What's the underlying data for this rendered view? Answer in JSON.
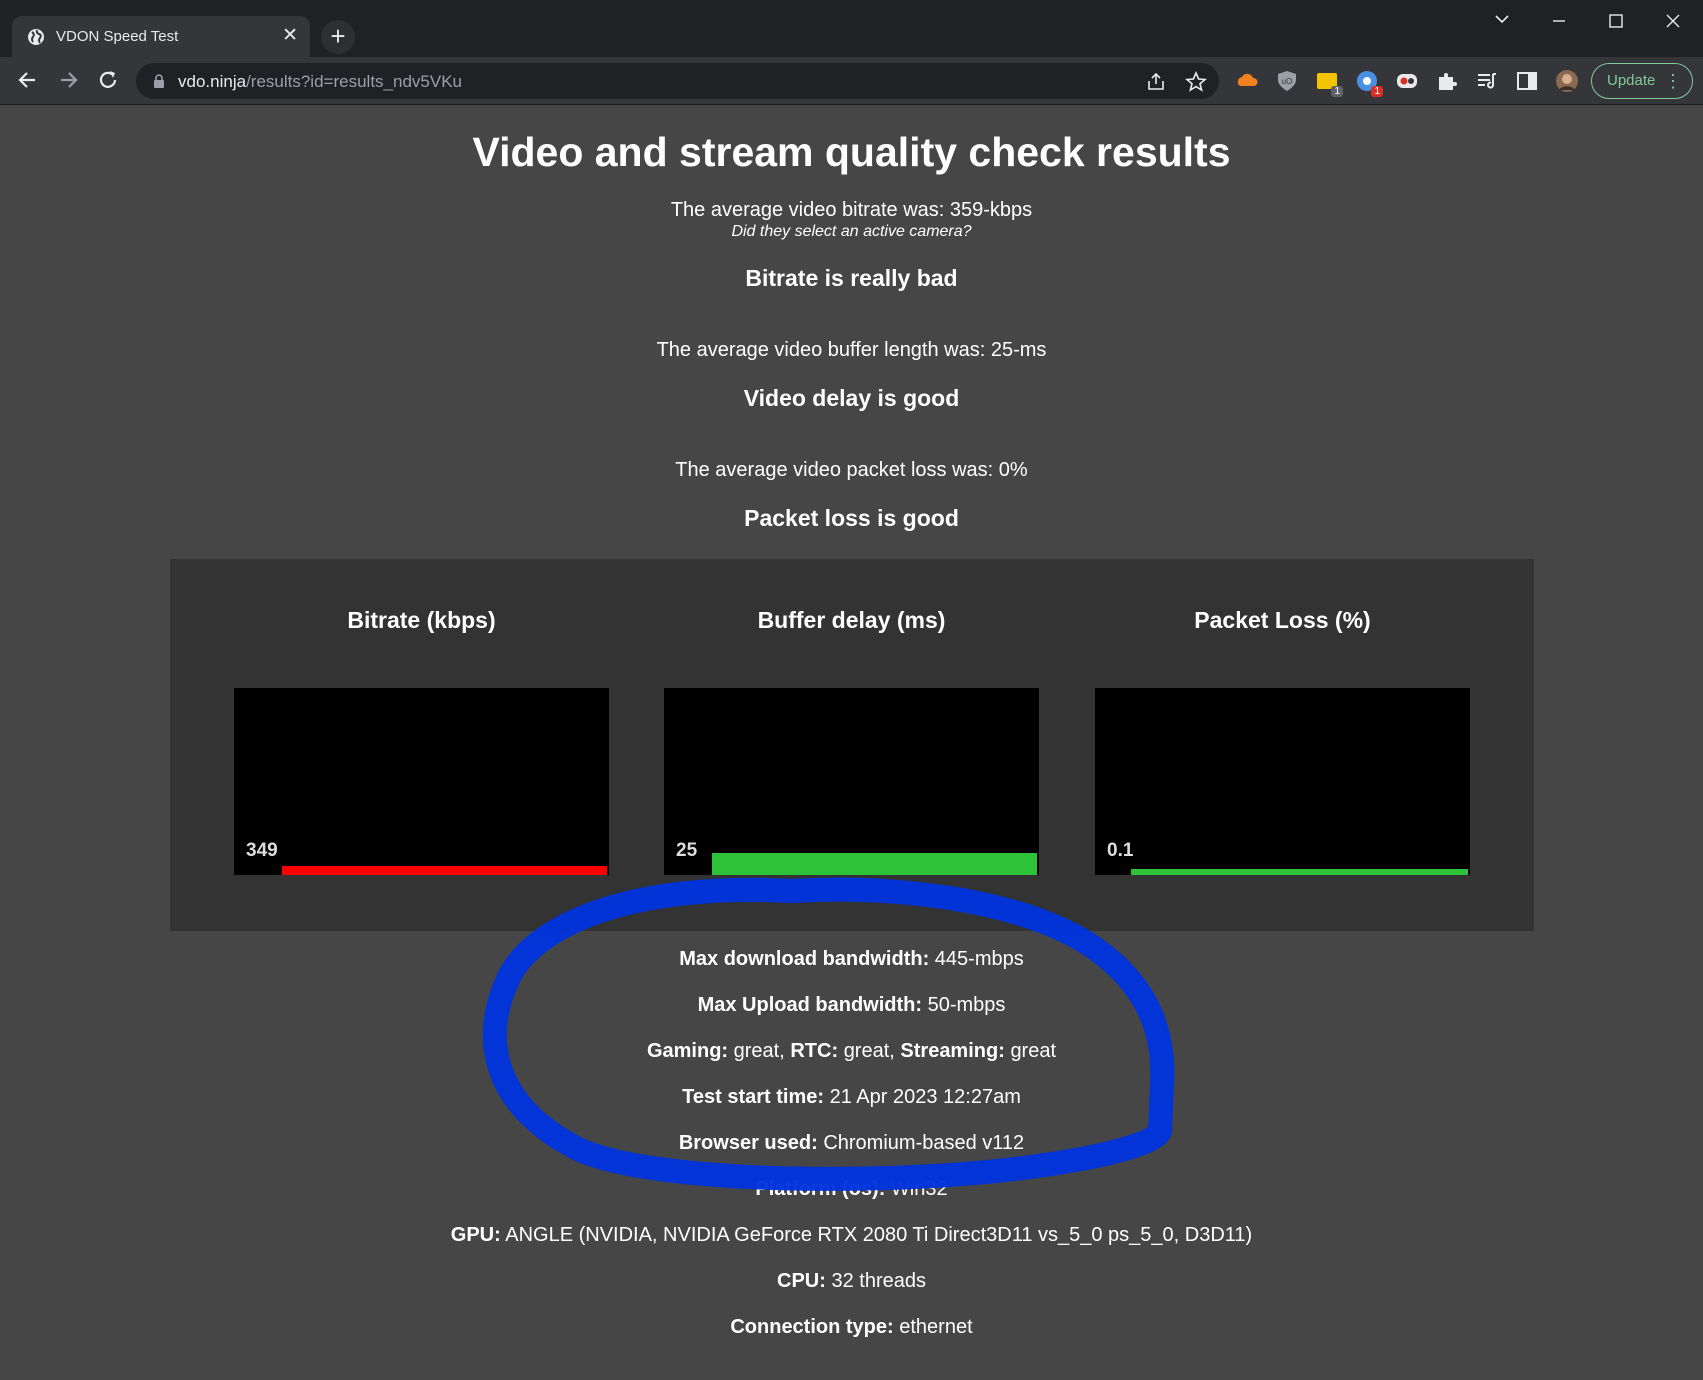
{
  "browser": {
    "tab_title": "VDON Speed Test",
    "url_host": "vdo.ninja",
    "url_path": "/results?id=results_ndv5VKu",
    "update_label": "Update",
    "extension_badges": [
      "1",
      "1"
    ]
  },
  "page": {
    "title": "Video and stream quality check results",
    "bitrate_line": "The average video bitrate was: 359-kbps",
    "bitrate_hint": "Did they select an active camera?",
    "bitrate_verdict": "Bitrate is really bad",
    "buffer_line": "The average video buffer length was: 25-ms",
    "buffer_verdict": "Video delay is good",
    "loss_line": "The average video packet loss was: 0%",
    "loss_verdict": "Packet loss is good"
  },
  "graphs": [
    {
      "title": "Bitrate (kbps)",
      "value_label": "349",
      "color": "#ff0000",
      "level": 0.05
    },
    {
      "title": "Buffer delay (ms)",
      "value_label": "25",
      "color": "#2ec23a",
      "level": 0.12
    },
    {
      "title": "Packet Loss (%)",
      "value_label": "0.1",
      "color": "#2ec23a",
      "level": 0.02
    }
  ],
  "stats": [
    {
      "label": "Max download bandwidth:",
      "value": "445-mbps"
    },
    {
      "label": "Max Upload bandwidth:",
      "value": "50-mbps"
    },
    {
      "gaming_label": "Gaming:",
      "gaming_value": "great,",
      "rtc_label": "RTC:",
      "rtc_value": "great,",
      "streaming_label": "Streaming:",
      "streaming_value": "great"
    },
    {
      "label": "Test start time:",
      "value": "21 Apr 2023 12:27am"
    },
    {
      "label": "Browser used:",
      "value": "Chromium-based v112"
    },
    {
      "label": "Platform (os):",
      "value": "Win32"
    },
    {
      "label": "GPU:",
      "value": "ANGLE (NVIDIA, NVIDIA GeForce RTX 2080 Ti Direct3D11 vs_5_0 ps_5_0, D3D11)"
    },
    {
      "label": "CPU:",
      "value": "32 threads"
    },
    {
      "label": "Connection type:",
      "value": "ethernet"
    }
  ],
  "colors": {
    "page_bg": "#464646",
    "panel_bg": "#333333",
    "annotation": "#0033dd",
    "bad": "#ff0000",
    "good": "#2ec23a"
  }
}
